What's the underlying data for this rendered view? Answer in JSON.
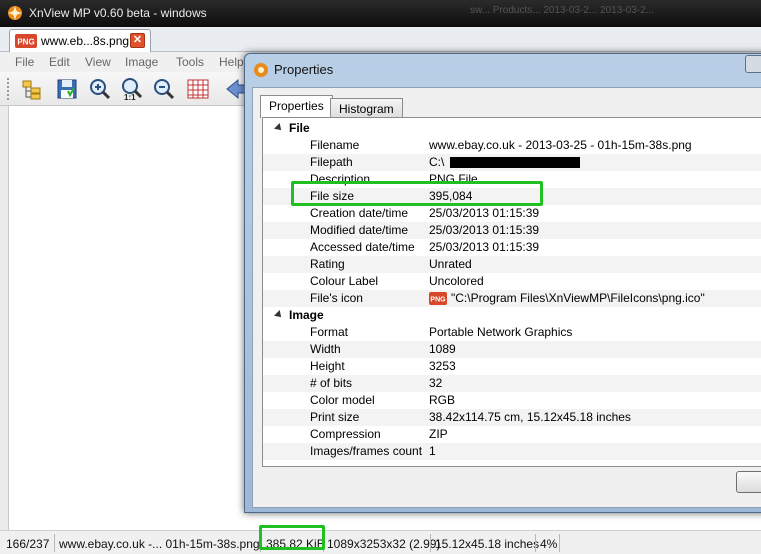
{
  "window": {
    "title": "XnView MP v0.60 beta - windows",
    "background_title_fragments": "sw... Products... 2013-03-2... 2013-03-2..."
  },
  "tab": {
    "label": "www.eb...8s.png",
    "close": "✕",
    "icon_text": "PNG"
  },
  "menu": [
    "File",
    "Edit",
    "View",
    "Image",
    "Tools",
    "Help"
  ],
  "toolbar_icons": [
    "browser-icon",
    "save-icon",
    "zoom-in-icon",
    "zoom-1to1-icon",
    "zoom-out-icon",
    "grid-icon",
    "back-arrow-icon"
  ],
  "dialog": {
    "title": "Properties",
    "tabs": [
      "Properties",
      "Histogram"
    ],
    "groups": [
      {
        "name": "File",
        "rows": [
          {
            "key": "Filename",
            "value": "www.ebay.co.uk - 2013-03-25 - 01h-15m-38s.png"
          },
          {
            "key": "Filepath",
            "value": "C:\\"
          },
          {
            "key": "Description",
            "value": "PNG File"
          },
          {
            "key": "File size",
            "value": "395,084"
          },
          {
            "key": "Creation date/time",
            "value": "25/03/2013 01:15:39"
          },
          {
            "key": "Modified date/time",
            "value": "25/03/2013 01:15:39"
          },
          {
            "key": "Accessed date/time",
            "value": "25/03/2013 01:15:39"
          },
          {
            "key": "Rating",
            "value": "Unrated"
          },
          {
            "key": "Colour Label",
            "value": "Uncolored"
          },
          {
            "key": "File's icon",
            "value": "\"C:\\Program Files\\XnViewMP\\FileIcons\\png.ico\""
          }
        ]
      },
      {
        "name": "Image",
        "rows": [
          {
            "key": "Format",
            "value": "Portable Network Graphics"
          },
          {
            "key": "Width",
            "value": "1089"
          },
          {
            "key": "Height",
            "value": "3253"
          },
          {
            "key": "# of bits",
            "value": "32"
          },
          {
            "key": "Color model",
            "value": "RGB"
          },
          {
            "key": "Print size",
            "value": "38.42x114.75 cm, 15.12x45.18 inches"
          },
          {
            "key": "Compression",
            "value": "ZIP"
          },
          {
            "key": "Images/frames count",
            "value": "1"
          }
        ]
      }
    ]
  },
  "status": {
    "index": "166/237",
    "filename": "www.ebay.co.uk -... 01h-15m-38s.png",
    "size": "385,82 KiB",
    "dimensions": "1089x3253x32 (2.99)",
    "print": "15.12x45.18 inches",
    "zoom": "4%"
  },
  "colors": {
    "highlight": "#21c021",
    "png_icon": "#d9472b"
  }
}
